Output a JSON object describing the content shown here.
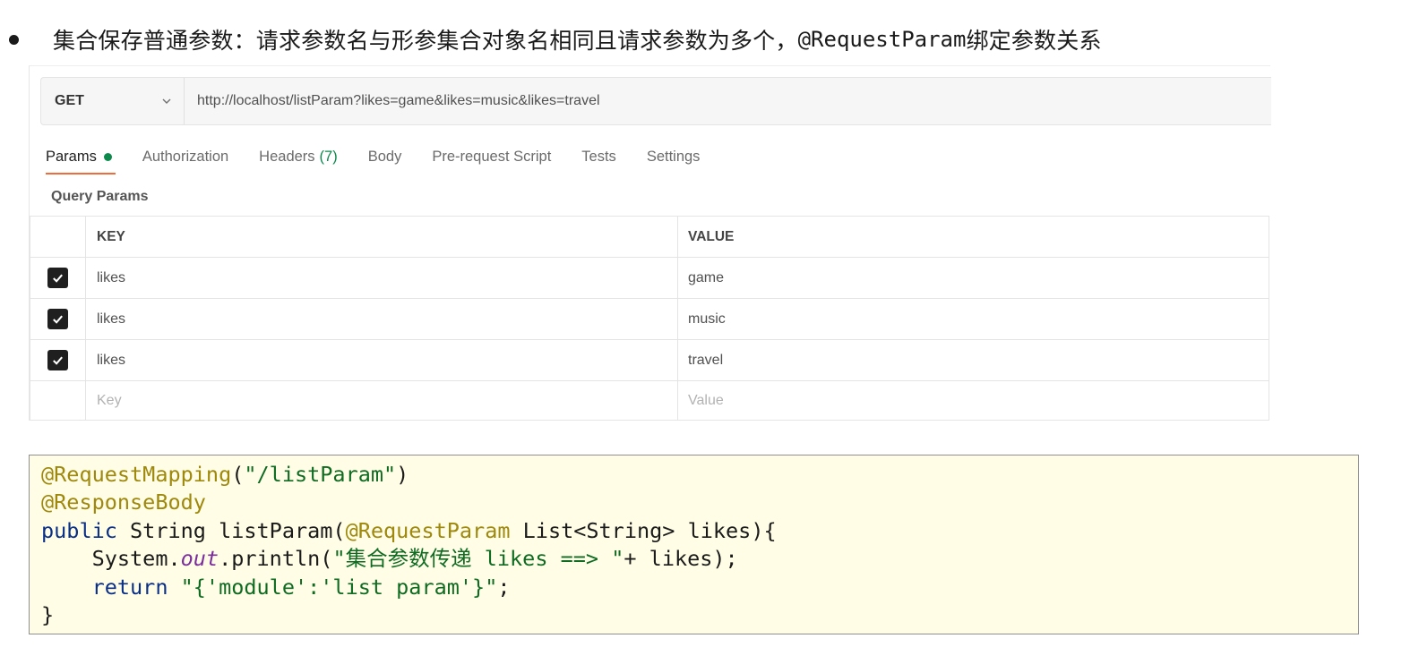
{
  "heading": {
    "text": "集合保存普通参数：请求参数名与形参集合对象名相同且请求参数为多个，",
    "code": "@RequestParam",
    "suffix": "绑定参数关系"
  },
  "request": {
    "method": "GET",
    "url": "http://localhost/listParam?likes=game&likes=music&likes=travel"
  },
  "tabs": [
    {
      "label": "Params"
    },
    {
      "label": "Authorization"
    },
    {
      "label": "Headers",
      "count": "(7)"
    },
    {
      "label": "Body"
    },
    {
      "label": "Pre-request Script"
    },
    {
      "label": "Tests"
    },
    {
      "label": "Settings"
    }
  ],
  "query_params": {
    "title": "Query Params",
    "headers": {
      "key": "KEY",
      "value": "VALUE"
    },
    "rows": [
      {
        "checked": true,
        "key": "likes",
        "value": "game"
      },
      {
        "checked": true,
        "key": "likes",
        "value": "music"
      },
      {
        "checked": true,
        "key": "likes",
        "value": "travel"
      }
    ],
    "placeholder": {
      "key": "Key",
      "value": "Value"
    }
  },
  "code": {
    "line1": {
      "ann": "@RequestMapping",
      "p1": "(",
      "str": "\"/listParam\"",
      "p2": ")"
    },
    "line2": {
      "ann": "@ResponseBody"
    },
    "line3": {
      "kw": "public",
      "t1": " String listParam(",
      "ann": "@RequestParam",
      "t2": " List<String> likes){"
    },
    "line4": {
      "indent": "    ",
      "t1": "System.",
      "ital": "out",
      "t2": ".println(",
      "str": "\"集合参数传递 likes ==> \"",
      "t3": "+ likes);"
    },
    "line5": {
      "indent": "    ",
      "kw": "return",
      "sp": " ",
      "str": "\"{'module':'list param'}\"",
      "t1": ";"
    },
    "line6": {
      "t1": "}"
    }
  },
  "colors": {
    "accent_dot": "#0c8a4c",
    "tab_underline": "#f26b3a",
    "code_bg": "#fffde6"
  }
}
